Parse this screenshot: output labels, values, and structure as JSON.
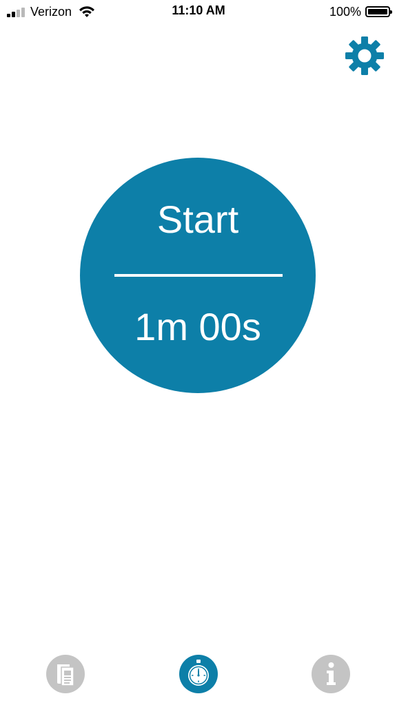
{
  "status_bar": {
    "carrier": "Verizon",
    "time": "11:10 AM",
    "battery_percent": "100%",
    "signal_bars_active": 2,
    "signal_bars_total": 4,
    "battery_level": 1.0
  },
  "settings": {
    "icon": "gear-icon"
  },
  "timer": {
    "start_label": "Start",
    "duration": "1m 00s"
  },
  "tab_bar": {
    "items": [
      {
        "icon": "notes-icon",
        "active": false
      },
      {
        "icon": "stopwatch-icon",
        "active": true
      },
      {
        "icon": "info-icon",
        "active": false
      }
    ]
  },
  "colors": {
    "accent": "#0d7fa8",
    "inactive": "#c4c4c4",
    "background": "#ffffff"
  }
}
